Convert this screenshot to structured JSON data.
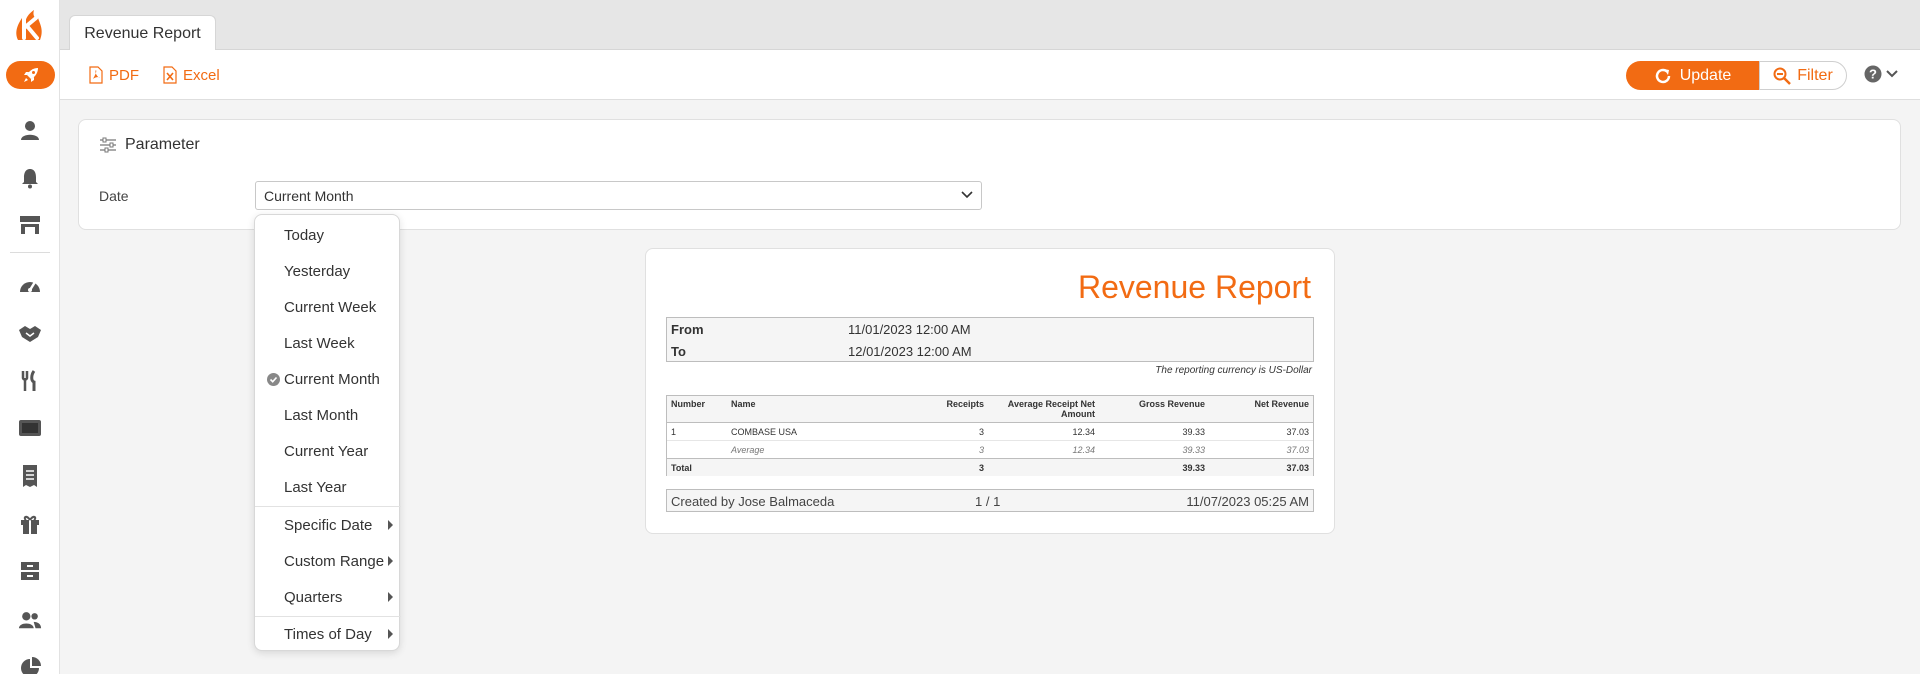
{
  "tabs": [
    {
      "label": "Revenue Report"
    }
  ],
  "toolbar": {
    "pdf_label": "PDF",
    "excel_label": "Excel",
    "update_label": "Update",
    "filter_label": "Filter"
  },
  "parameter": {
    "title": "Parameter",
    "date_label": "Date",
    "date_value": "Current Month"
  },
  "dropdown": {
    "items": [
      {
        "label": "Today"
      },
      {
        "label": "Yesterday"
      },
      {
        "label": "Current Week"
      },
      {
        "label": "Last Week"
      },
      {
        "label": "Current Month",
        "selected": true
      },
      {
        "label": "Last Month"
      },
      {
        "label": "Current Year"
      },
      {
        "label": "Last Year"
      },
      {
        "label": "Specific Date",
        "submenu": true
      },
      {
        "label": "Custom Range",
        "submenu": true
      },
      {
        "label": "Quarters",
        "submenu": true
      },
      {
        "label": "Times of Day",
        "submenu": true
      }
    ]
  },
  "report": {
    "title": "Revenue Report",
    "from_label": "From",
    "from_value": "11/01/2023 12:00 AM",
    "to_label": "To",
    "to_value": "12/01/2023 12:00 AM",
    "currency_note": "The reporting currency is US-Dollar",
    "columns": [
      "Number",
      "Name",
      "Receipts",
      "Average Receipt Net Amount",
      "Gross Revenue",
      "Net Revenue"
    ],
    "rows": [
      {
        "number": "1",
        "name": "COMBASE USA",
        "receipts": "3",
        "avg": "12.34",
        "gross": "39.33",
        "net": "37.03"
      },
      {
        "number": "",
        "name": "Average",
        "receipts": "3",
        "avg": "12.34",
        "gross": "39.33",
        "net": "37.03"
      },
      {
        "number": "Total",
        "name": "",
        "receipts": "3",
        "avg": "",
        "gross": "39.33",
        "net": "37.03"
      }
    ],
    "footer": {
      "created_by": "Created by Jose Balmaceda",
      "page": "1  /  1",
      "timestamp": "11/07/2023 05:25 AM"
    }
  },
  "colors": {
    "accent": "#f26b13"
  }
}
